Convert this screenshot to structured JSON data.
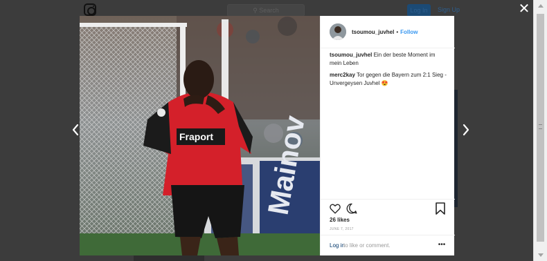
{
  "background": {
    "search_placeholder": "Search",
    "login_label": "Log In",
    "signup_label": "Sign Up"
  },
  "post": {
    "author": "tsoumou_juvhel",
    "separator": "•",
    "follow_label": "Follow",
    "comments": [
      {
        "user": "tsoumou_juvhel",
        "text": "Ein der beste Moment im mein Leben"
      },
      {
        "user": "merc2kay",
        "text": "Tor gegen die Bayern zum 2:1 Sieg - Unvergeysen Juvhel 😍"
      }
    ],
    "likes": "26 likes",
    "date": "JUNE 7, 2017",
    "login_link": "Log in",
    "login_rest": "to like or comment.",
    "more_label": "•••",
    "photo": {
      "sponsor": "Fraport"
    }
  },
  "overlay": {
    "close_label": "✕"
  },
  "icons": {
    "close": "close-icon",
    "prev": "chevron-left-icon",
    "next": "chevron-right-icon",
    "like": "heart-icon",
    "comment": "comment-bubble-icon",
    "save": "bookmark-icon",
    "more": "more-options-icon"
  },
  "colors": {
    "follow": "#3897f0",
    "login_link": "#003569",
    "jersey_red": "#d4202a",
    "overlay": "#3c3c3c"
  }
}
